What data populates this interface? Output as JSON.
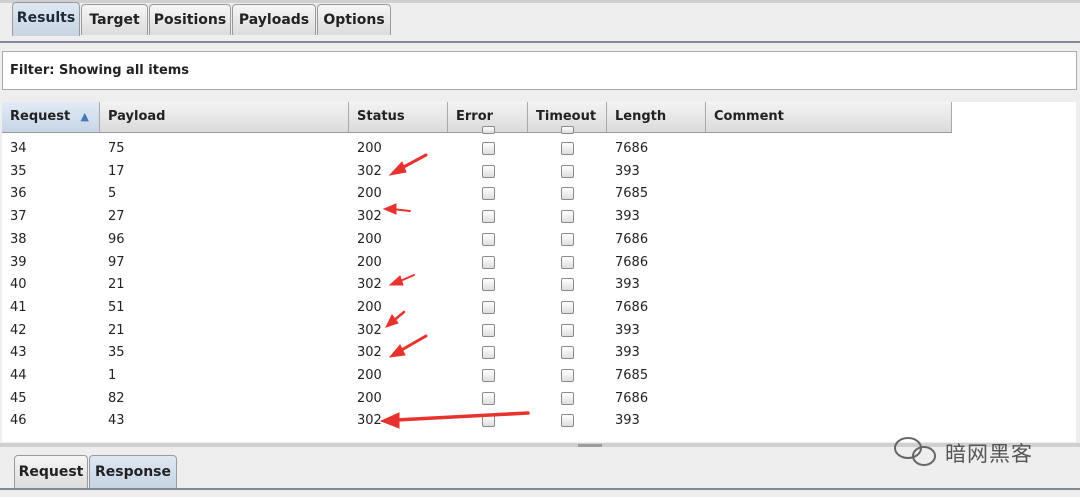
{
  "tabs": [
    "Results",
    "Target",
    "Positions",
    "Payloads",
    "Options"
  ],
  "filter": {
    "text": "Filter: Showing all items"
  },
  "table": {
    "columns": [
      "Request",
      "Payload",
      "Status",
      "Error",
      "Timeout",
      "Length",
      "Comment"
    ],
    "sort_indicator": "▲",
    "rows": [
      {
        "request": "34",
        "payload": "75",
        "status": "200",
        "error": false,
        "timeout": false,
        "length": "7686",
        "comment": ""
      },
      {
        "request": "35",
        "payload": "17",
        "status": "302",
        "error": false,
        "timeout": false,
        "length": "393",
        "comment": ""
      },
      {
        "request": "36",
        "payload": "5",
        "status": "200",
        "error": false,
        "timeout": false,
        "length": "7685",
        "comment": ""
      },
      {
        "request": "37",
        "payload": "27",
        "status": "302",
        "error": false,
        "timeout": false,
        "length": "393",
        "comment": ""
      },
      {
        "request": "38",
        "payload": "96",
        "status": "200",
        "error": false,
        "timeout": false,
        "length": "7686",
        "comment": ""
      },
      {
        "request": "39",
        "payload": "97",
        "status": "200",
        "error": false,
        "timeout": false,
        "length": "7686",
        "comment": ""
      },
      {
        "request": "40",
        "payload": "21",
        "status": "302",
        "error": false,
        "timeout": false,
        "length": "393",
        "comment": ""
      },
      {
        "request": "41",
        "payload": "51",
        "status": "200",
        "error": false,
        "timeout": false,
        "length": "7686",
        "comment": ""
      },
      {
        "request": "42",
        "payload": "21",
        "status": "302",
        "error": false,
        "timeout": false,
        "length": "393",
        "comment": ""
      },
      {
        "request": "43",
        "payload": "35",
        "status": "302",
        "error": false,
        "timeout": false,
        "length": "393",
        "comment": ""
      },
      {
        "request": "44",
        "payload": "1",
        "status": "200",
        "error": false,
        "timeout": false,
        "length": "7685",
        "comment": ""
      },
      {
        "request": "45",
        "payload": "82",
        "status": "200",
        "error": false,
        "timeout": false,
        "length": "7686",
        "comment": ""
      },
      {
        "request": "46",
        "payload": "43",
        "status": "302",
        "error": false,
        "timeout": false,
        "length": "393",
        "comment": ""
      }
    ]
  },
  "bottom_tabs": [
    "Request",
    "Response"
  ],
  "watermark": "暗网黑客",
  "colors": {
    "annotation_arrow": "#e8322e",
    "active_tab": "#c7d4e3"
  }
}
